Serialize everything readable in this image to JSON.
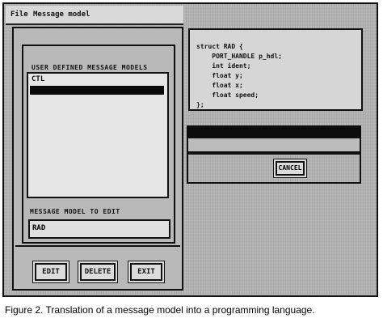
{
  "menu": {
    "file": "File",
    "model": "Message model"
  },
  "left_panel": {
    "list_label": "USER DEFINED MESSAGE MODELS",
    "items": [
      "CTL",
      ""
    ],
    "edit_label": "MESSAGE MODEL TO EDIT",
    "edit_value": "RAD",
    "buttons": {
      "edit": "EDIT",
      "delete": "DELETE",
      "exit": "EXIT"
    }
  },
  "code": {
    "lines": [
      "struct RAD {",
      "    PORT_HANDLE p_hdl;",
      "    int ident;",
      "    float y;",
      "    float x;",
      "    float speed;",
      "};"
    ]
  },
  "cancel_label": "CANCEL",
  "caption": "Figure 2. Translation of a message model into a programming language."
}
